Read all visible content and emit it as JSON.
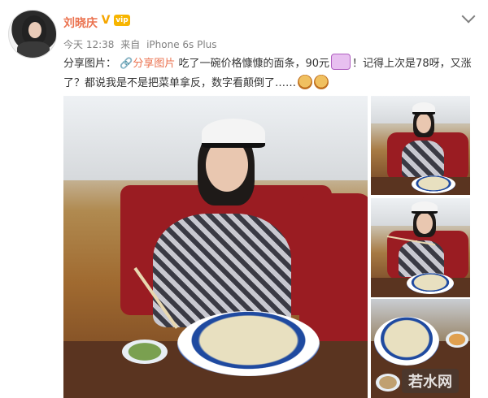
{
  "post": {
    "author_name": "刘晓庆",
    "verified_badge": "V",
    "member_badge": "vip",
    "time": "今天 12:38",
    "source_prefix": "来自",
    "source_device": "iPhone 6s Plus",
    "text_part1": "分享图片：",
    "link_text": "分享图片",
    "text_part2": "吃了一碗价格慷慷的面条，90元",
    "text_part3": "！记得上次是78呀，又涨了？都说我是不是把菜单拿反，数字看颠倒了……",
    "icons": {
      "menu": "chevron-down-icon",
      "link": "link-icon",
      "emoji_face": "shocked-face-emoji",
      "emoji_doge": "doge-emoji"
    }
  },
  "images": {
    "watermark_text": "若水网"
  },
  "colors": {
    "name": "#eb7350",
    "link": "#eb7350",
    "meta": "#808080",
    "verified": "#f6a600"
  }
}
